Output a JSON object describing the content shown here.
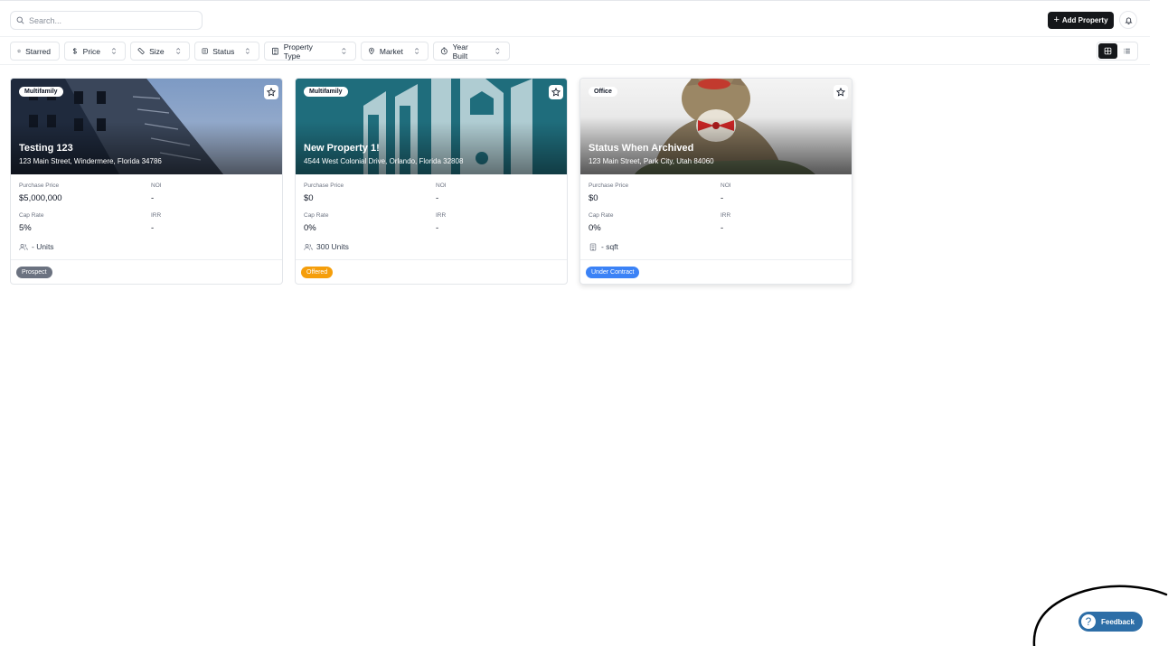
{
  "search": {
    "placeholder": "Search..."
  },
  "header": {
    "add_label": "Add Property"
  },
  "filters": [
    {
      "label": "Starred",
      "icon": "star-icon"
    },
    {
      "label": "Price",
      "icon": "dollar-icon"
    },
    {
      "label": "Size",
      "icon": "ruler-icon"
    },
    {
      "label": "Status",
      "icon": "status-icon"
    },
    {
      "label": "Property Type",
      "icon": "building-icon"
    },
    {
      "label": "Market",
      "icon": "map-pin-icon"
    },
    {
      "label": "Year Built",
      "icon": "clock-icon"
    }
  ],
  "view": {
    "active": "grid"
  },
  "properties": [
    {
      "type": "Multifamily",
      "name": "Testing 123",
      "address": "123 Main Street, Windermere, Florida 34786",
      "purchase_price_label": "Purchase Price",
      "purchase_price": "$5,000,000",
      "noi_label": "NOI",
      "noi": "-",
      "cap_rate_label": "Cap Rate",
      "cap_rate": "5%",
      "irr_label": "IRR",
      "irr": "-",
      "size": "- Units",
      "size_icon": "users-icon",
      "status": "Prospect",
      "status_color": "#6b7280"
    },
    {
      "type": "Multifamily",
      "name": "New Property 1!",
      "address": "4544 West Colonial Drive, Orlando, Florida 32808",
      "purchase_price_label": "Purchase Price",
      "purchase_price": "$0",
      "noi_label": "NOI",
      "noi": "-",
      "cap_rate_label": "Cap Rate",
      "cap_rate": "0%",
      "irr_label": "IRR",
      "irr": "-",
      "size": "300 Units",
      "size_icon": "users-icon",
      "status": "Offered",
      "status_color": "#f59e0b"
    },
    {
      "type": "Office",
      "name": "Status When Archived",
      "address": "123 Main Street, Park City, Utah 84060",
      "purchase_price_label": "Purchase Price",
      "purchase_price": "$0",
      "noi_label": "NOI",
      "noi": "-",
      "cap_rate_label": "Cap Rate",
      "cap_rate": "0%",
      "irr_label": "IRR",
      "irr": "-",
      "size": "- sqft",
      "size_icon": "building-icon",
      "status": "Under Contract",
      "status_color": "#3b82f6"
    }
  ],
  "feedback": {
    "label": "Feedback",
    "icon_glyph": "?"
  },
  "colors": {
    "primary": "#15171a",
    "feedback": "#2d6ea7"
  }
}
